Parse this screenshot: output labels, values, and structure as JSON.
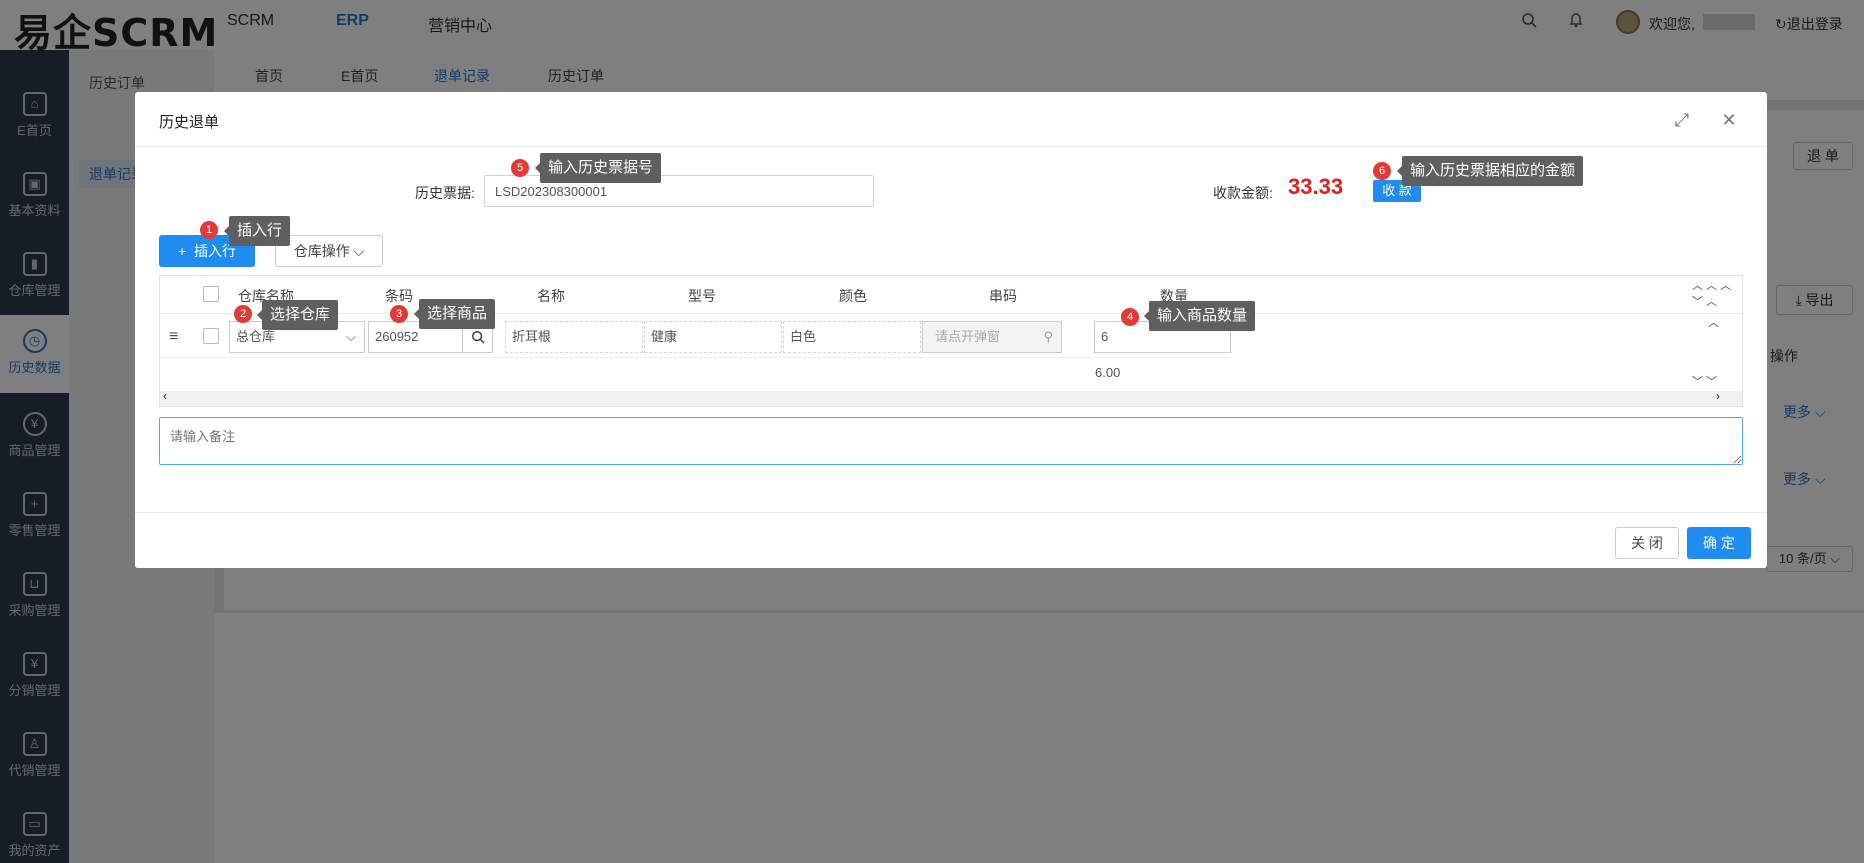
{
  "header": {
    "logo": "易企SCRM",
    "nav": [
      "SCRM",
      "ERP",
      "营销中心"
    ],
    "active_nav": "ERP",
    "welcome": "欢迎您,",
    "logout": "退出登录"
  },
  "sidebar": {
    "items": [
      {
        "label": "E首页",
        "icon": "home-icon"
      },
      {
        "label": "基本资料",
        "icon": "bag-icon"
      },
      {
        "label": "仓库管理",
        "icon": "chart-icon"
      },
      {
        "label": "历史数据",
        "icon": "clock-icon"
      },
      {
        "label": "商品管理",
        "icon": "yen-icon"
      },
      {
        "label": "零售管理",
        "icon": "retail-icon"
      },
      {
        "label": "采购管理",
        "icon": "cart-icon"
      },
      {
        "label": "分销管理",
        "icon": "distribution-icon"
      },
      {
        "label": "代销管理",
        "icon": "consign-icon"
      },
      {
        "label": "我的资产",
        "icon": "wallet-icon"
      }
    ],
    "active": "历史数据"
  },
  "subnav": {
    "items": [
      "历史订单",
      "退单记录"
    ]
  },
  "page_tabs": {
    "items": [
      "首页",
      "E首页",
      "退单记录",
      "历史订单"
    ],
    "active": "退单记录"
  },
  "background": {
    "return_btn": "退 单",
    "export_btn": "导出",
    "op_header": "操作",
    "more_link": "更多",
    "page_size": "10 条/页"
  },
  "modal": {
    "title": "历史退单",
    "ticket_label": "历史票据:",
    "ticket_value": "LSD202308300001",
    "amount_label": "收款金额:",
    "amount": "33.33",
    "pay_button": "收 款",
    "insert_button": "插入行",
    "warehouse_button": "仓库操作",
    "columns": [
      "仓库名称",
      "条码",
      "名称",
      "型号",
      "颜色",
      "串码",
      "数量"
    ],
    "row": {
      "warehouse": "总仓库",
      "barcode": "260952",
      "name": "折耳根",
      "model": "健康",
      "color": "白色",
      "serial_placeholder": "请点开弹窗",
      "qty": "6"
    },
    "total_qty": "6.00",
    "remark_placeholder": "请输入备注",
    "close_button": "关 闭",
    "ok_button": "确 定"
  },
  "annotations": [
    {
      "num": "1",
      "text": "插入行"
    },
    {
      "num": "2",
      "text": "选择仓库"
    },
    {
      "num": "3",
      "text": "选择商品"
    },
    {
      "num": "4",
      "text": "输入商品数量"
    },
    {
      "num": "5",
      "text": "输入历史票据号"
    },
    {
      "num": "6",
      "text": "输入历史票据相应的金额"
    }
  ]
}
